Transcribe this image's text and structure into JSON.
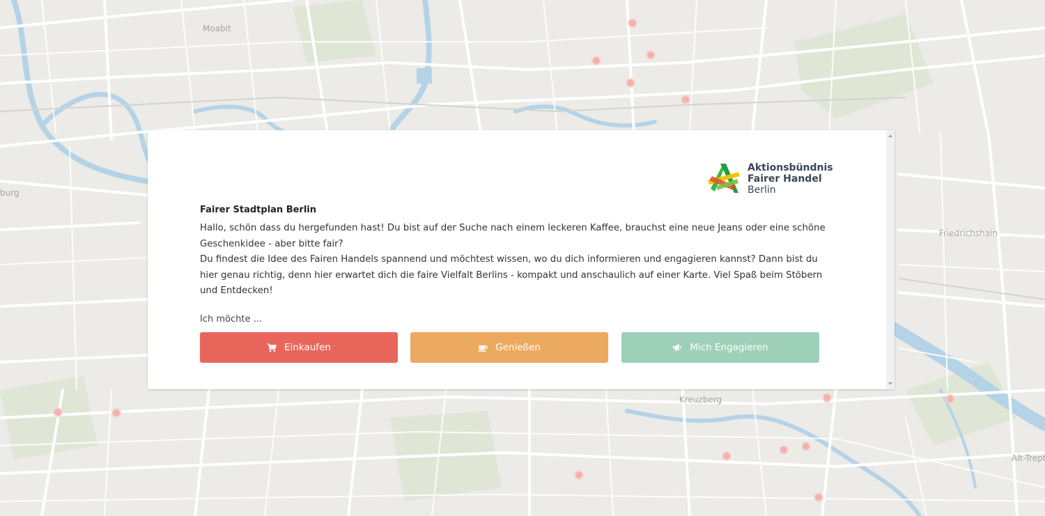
{
  "map": {
    "labels": [
      {
        "text": "Moabit"
      },
      {
        "text": "burg"
      },
      {
        "text": "Friedrichshain"
      },
      {
        "text": "Kreuzberg"
      },
      {
        "text": "Alt-Trept"
      }
    ],
    "marker_color": "#f1b3ae"
  },
  "modal": {
    "logo": {
      "line1": "Aktionsbündnis",
      "line2": "Fairer Handel",
      "line3": "Berlin"
    },
    "title": "Fairer Stadtplan Berlin",
    "paragraph1": "Hallo, schön dass du hergefunden hast! Du bist auf der Suche nach einem leckeren Kaffee, brauchst eine neue Jeans oder eine schöne Geschenkidee - aber bitte fair?",
    "paragraph2": "Du findest die Idee des Fairen Handels spannend und möchtest wissen, wo du dich informieren und engagieren kannst? Dann bist du hier genau richtig, denn hier erwartet dich die faire Vielfalt Berlins - kompakt und anschaulich auf einer Karte. Viel Spaß beim Stöbern und Entdecken!",
    "choose_label": "Ich möchte ...",
    "buttons": [
      {
        "label": "Einkaufen",
        "icon": "shopping-cart-icon",
        "color": "#e9665d"
      },
      {
        "label": "Genießen",
        "icon": "coffee-cup-icon",
        "color": "#ecaa61"
      },
      {
        "label": "Mich Engagieren",
        "icon": "megaphone-icon",
        "color": "#9ed0b9"
      }
    ]
  }
}
